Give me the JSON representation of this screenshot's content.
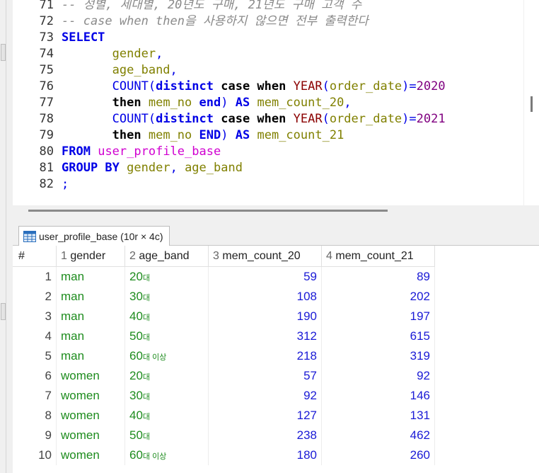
{
  "editor": {
    "lines": [
      {
        "no": "71",
        "html": "<span class='cm'>-- 성별, 세대별, 20년도 구매, 21년도 구매 고객 수</span>"
      },
      {
        "no": "72",
        "html": "<span class='cm'>-- case when then을 사용하지 않으면 전부 출력한다</span>"
      },
      {
        "no": "73",
        "html": "<span class='kb'>SELECT</span>"
      },
      {
        "no": "74",
        "html": "       <span class='col'>gender</span><span class='pc'>,</span>"
      },
      {
        "no": "75",
        "html": "       <span class='col'>age_band</span><span class='pc'>,</span>"
      },
      {
        "no": "76",
        "html": "       <span class='fn'>COUNT</span><span class='pc'>(</span><span class='kb'>distinct</span> <span class='kbk'>case when</span> <span class='yr'>YEAR</span><span class='pc'>(</span><span class='col'>order_date</span><span class='pc'>)=</span><span class='num'>2020</span>"
      },
      {
        "no": "77",
        "html": "       <span class='kbk'>then</span> <span class='col'>mem_no</span> <span class='kb'>end</span><span class='pc'>)</span> <span class='kb'>AS</span> <span class='col'>mem_count_20</span><span class='pc'>,</span>"
      },
      {
        "no": "78",
        "html": "       <span class='fn'>COUNT</span><span class='pc'>(</span><span class='kb'>distinct</span> <span class='kbk'>case when</span> <span class='yr'>YEAR</span><span class='pc'>(</span><span class='col'>order_date</span><span class='pc'>)=</span><span class='num'>2021</span>"
      },
      {
        "no": "79",
        "html": "       <span class='kbk'>then</span> <span class='col'>mem_no</span> <span class='kb'>END</span><span class='pc'>)</span> <span class='kb'>AS</span> <span class='col'>mem_count_21</span>"
      },
      {
        "no": "80",
        "html": "<span class='kb'>FROM</span> <span class='tbl'>user_profile_base</span>"
      },
      {
        "no": "81",
        "html": "<span class='kb'>GROUP BY</span> <span class='col'>gender</span><span class='pc'>,</span> <span class='col'>age_band</span>"
      },
      {
        "no": "82",
        "html": "<span class='pc'>;</span>"
      }
    ]
  },
  "result_tab": {
    "label": "user_profile_base (10r × 4c)",
    "icon": "table-grid-icon"
  },
  "grid": {
    "rownum_header": "#",
    "columns": [
      {
        "num": "1",
        "name": "gender"
      },
      {
        "num": "2",
        "name": "age_band"
      },
      {
        "num": "3",
        "name": "mem_count_20"
      },
      {
        "num": "4",
        "name": "mem_count_21"
      }
    ],
    "rows": [
      {
        "n": "1",
        "gender": "man",
        "age": "20",
        "suffix": "대",
        "c20": "59",
        "c21": "89"
      },
      {
        "n": "2",
        "gender": "man",
        "age": "30",
        "suffix": "대",
        "c20": "108",
        "c21": "202"
      },
      {
        "n": "3",
        "gender": "man",
        "age": "40",
        "suffix": "대",
        "c20": "190",
        "c21": "197"
      },
      {
        "n": "4",
        "gender": "man",
        "age": "50",
        "suffix": "대",
        "c20": "312",
        "c21": "615"
      },
      {
        "n": "5",
        "gender": "man",
        "age": "60",
        "suffix": "대 이상",
        "c20": "218",
        "c21": "319"
      },
      {
        "n": "6",
        "gender": "women",
        "age": "20",
        "suffix": "대",
        "c20": "57",
        "c21": "92"
      },
      {
        "n": "7",
        "gender": "women",
        "age": "30",
        "suffix": "대",
        "c20": "92",
        "c21": "146"
      },
      {
        "n": "8",
        "gender": "women",
        "age": "40",
        "suffix": "대",
        "c20": "127",
        "c21": "131"
      },
      {
        "n": "9",
        "gender": "women",
        "age": "50",
        "suffix": "대",
        "c20": "238",
        "c21": "462"
      },
      {
        "n": "10",
        "gender": "women",
        "age": "60",
        "suffix": "대 이상",
        "c20": "180",
        "c21": "260"
      }
    ]
  }
}
